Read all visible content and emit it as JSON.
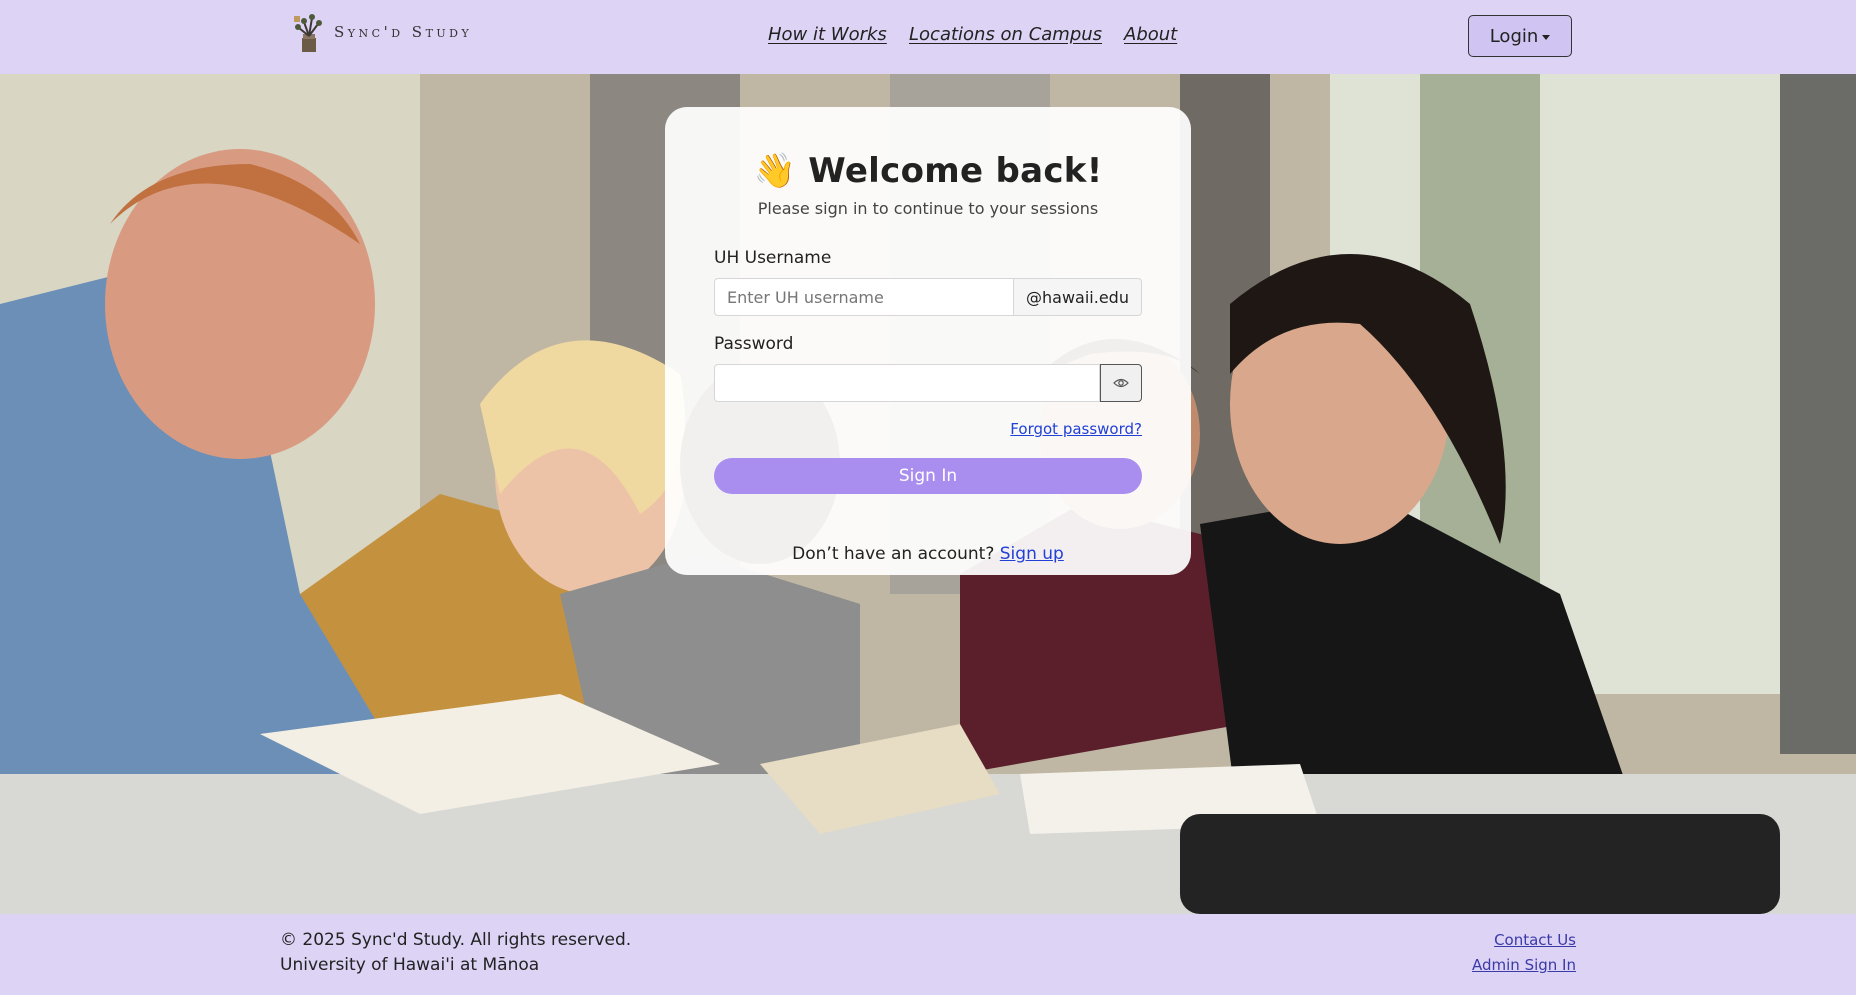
{
  "header": {
    "brand_name": "Sync'd Study",
    "nav": [
      "How it Works",
      "Locations on Campus",
      "About"
    ],
    "login_label": "Login"
  },
  "login_card": {
    "emoji": "👋",
    "title": "Welcome back!",
    "subtitle": "Please sign in to continue to your sessions",
    "username_label": "UH Username",
    "username_placeholder": "Enter UH username",
    "username_value": "",
    "username_domain": "@hawaii.edu",
    "password_label": "Password",
    "password_value": "",
    "forgot_label": "Forgot password?",
    "signin_label": "Sign In",
    "signup_prompt": "Don’t have an account?",
    "signup_label": "Sign up"
  },
  "footer": {
    "copyright": "© 2025 Sync'd Study. All rights reserved.",
    "university": "University of Hawai'i at Mānoa",
    "contact_label": "Contact Us",
    "admin_label": "Admin Sign In"
  },
  "colors": {
    "navbar_bg": "#ddd3f5",
    "login_button_bg": "#d0c4f2",
    "signin_button_bg": "#a98ef0",
    "link_blue": "#2140d6"
  },
  "icons": [
    "brand-logo-icon",
    "eye-icon",
    "caret-down-icon"
  ]
}
